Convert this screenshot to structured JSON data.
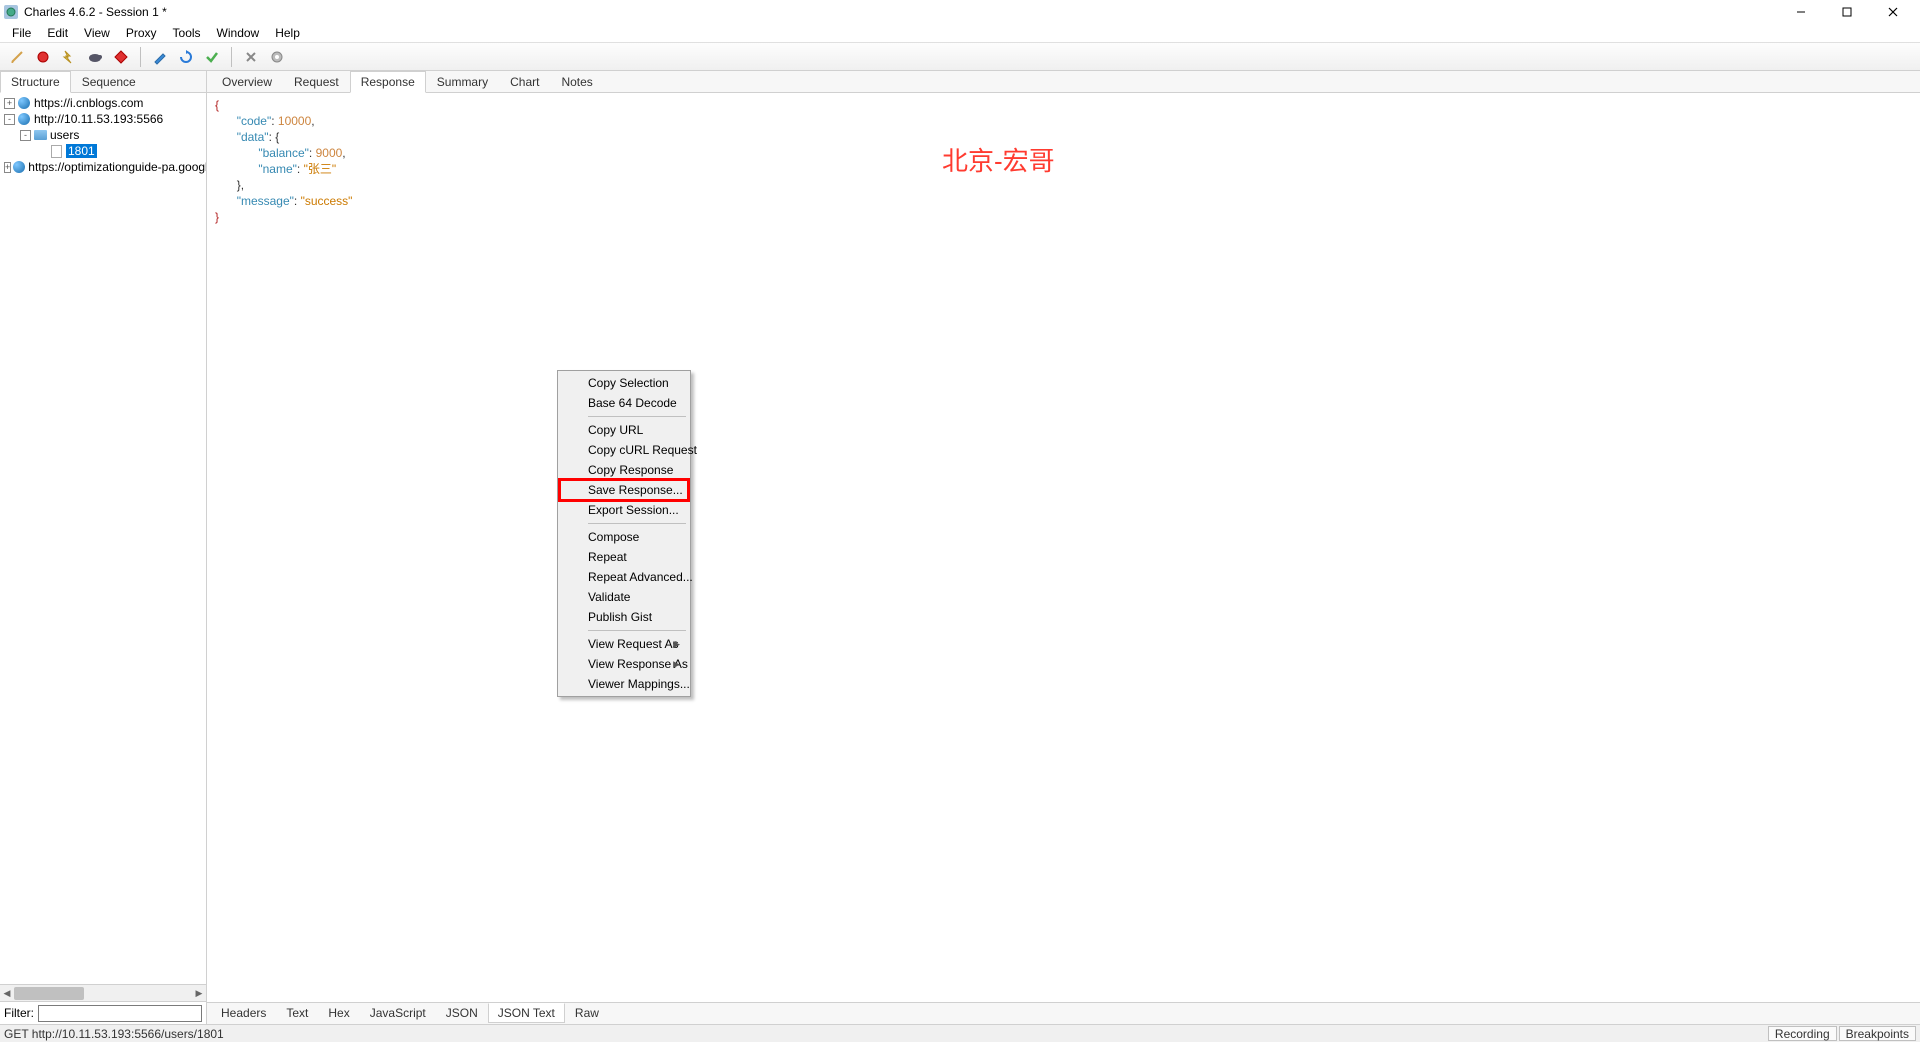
{
  "window": {
    "title": "Charles 4.6.2 - Session 1 *"
  },
  "menu": {
    "items": [
      "File",
      "Edit",
      "View",
      "Proxy",
      "Tools",
      "Window",
      "Help"
    ]
  },
  "toolbar_icons": [
    "broom",
    "record",
    "lightning-off",
    "turtle",
    "breakpoint",
    "pencil",
    "refresh",
    "check",
    "scissors",
    "wrench-gear",
    "globe-gray"
  ],
  "left": {
    "tabs": [
      "Structure",
      "Sequence"
    ],
    "active_tab": 0,
    "tree": [
      {
        "depth": 0,
        "expander": "+",
        "icon": "globe",
        "label": "https://i.cnblogs.com",
        "selected": false
      },
      {
        "depth": 0,
        "expander": "-",
        "icon": "globe",
        "label": "http://10.11.53.193:5566",
        "selected": false
      },
      {
        "depth": 1,
        "expander": "-",
        "icon": "folder",
        "label": "users",
        "selected": false
      },
      {
        "depth": 2,
        "expander": "",
        "icon": "file",
        "label": "1801",
        "selected": true
      },
      {
        "depth": 0,
        "expander": "+",
        "icon": "globe",
        "label": "https://optimizationguide-pa.googlea",
        "selected": false
      }
    ],
    "filter_label": "Filter:"
  },
  "right": {
    "tabs": [
      "Overview",
      "Request",
      "Response",
      "Summary",
      "Chart",
      "Notes"
    ],
    "active_tab": 2,
    "bottom_tabs": [
      "Headers",
      "Text",
      "Hex",
      "JavaScript",
      "JSON",
      "JSON Text",
      "Raw"
    ],
    "active_bottom_tab": 5,
    "json": {
      "l1": "{",
      "l2_k": "\"code\"",
      "l2_p": ": ",
      "l2_v": "10000",
      "l2_c": ",",
      "l3_k": "\"data\"",
      "l3_p": ": {",
      "l4_k": "\"balance\"",
      "l4_p": ": ",
      "l4_v": "9000",
      "l4_c": ",",
      "l5_k": "\"name\"",
      "l5_p": ": ",
      "l5_v": "\"张三\"",
      "l6": "},",
      "l7_k": "\"message\"",
      "l7_p": ": ",
      "l7_v": "\"success\"",
      "l8": "}"
    },
    "watermark": "北京-宏哥"
  },
  "context_menu": {
    "items": [
      {
        "label": "Copy Selection",
        "type": "item"
      },
      {
        "label": "Base 64 Decode",
        "type": "item"
      },
      {
        "type": "sep"
      },
      {
        "label": "Copy URL",
        "type": "item"
      },
      {
        "label": "Copy cURL Request",
        "type": "item"
      },
      {
        "label": "Copy Response",
        "type": "item"
      },
      {
        "label": "Save Response...",
        "type": "item",
        "highlight": true
      },
      {
        "label": "Export Session...",
        "type": "item"
      },
      {
        "type": "sep"
      },
      {
        "label": "Compose",
        "type": "item"
      },
      {
        "label": "Repeat",
        "type": "item"
      },
      {
        "label": "Repeat Advanced...",
        "type": "item"
      },
      {
        "label": "Validate",
        "type": "item"
      },
      {
        "label": "Publish Gist",
        "type": "item"
      },
      {
        "type": "sep"
      },
      {
        "label": "View Request As",
        "type": "item",
        "submenu": true
      },
      {
        "label": "View Response As",
        "type": "item",
        "submenu": true
      },
      {
        "label": "Viewer Mappings...",
        "type": "item"
      }
    ]
  },
  "status": {
    "text": "GET http://10.11.53.193:5566/users/1801",
    "recording": "Recording",
    "breakpoints": "Breakpoints"
  }
}
